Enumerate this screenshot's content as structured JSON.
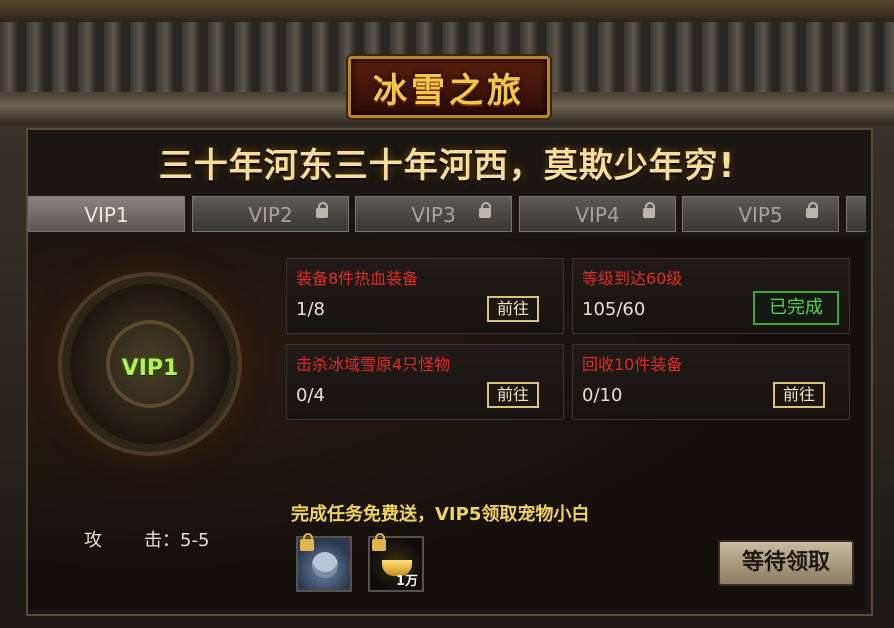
{
  "game": {
    "title": "冰雪之旅",
    "slogan": "三十年河东三十年河西，莫欺少年穷!"
  },
  "tabs": [
    {
      "label": "VIP1",
      "active": true,
      "locked": false
    },
    {
      "label": "VIP2",
      "active": false,
      "locked": true
    },
    {
      "label": "VIP3",
      "active": false,
      "locked": true
    },
    {
      "label": "VIP4",
      "active": false,
      "locked": true
    },
    {
      "label": "VIP5",
      "active": false,
      "locked": true
    }
  ],
  "vip_badge": "VIP1",
  "tasks": [
    {
      "title": "装备8件热血装备",
      "progress": "1/8",
      "button": "前往"
    },
    {
      "title": "等级到达60级",
      "progress": "105/60",
      "button": "已完成"
    },
    {
      "title": "击杀冰域雪原4只怪物",
      "progress": "0/4",
      "button": "前往"
    },
    {
      "title": "回收10件装备",
      "progress": "0/10",
      "button": "前往"
    }
  ],
  "reward": {
    "title": "完成任务免费送，VIP5领取宠物小白",
    "stat_label": "攻",
    "stat_value": "击：5-5",
    "items": [
      {
        "icon": "wolf-pet-icon",
        "qty": ""
      },
      {
        "icon": "gold-ingot-icon",
        "qty": "1万"
      }
    ],
    "claim_button": "等待领取"
  },
  "colors": {
    "task_title": "#e02a23",
    "done": "#4fd24a",
    "reward_title": "#f0d45a",
    "vip_badge": "#b6ef5a"
  }
}
